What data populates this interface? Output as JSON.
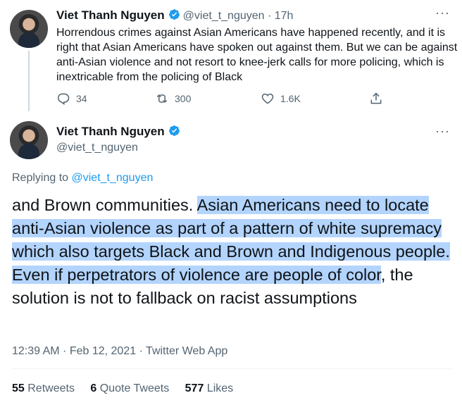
{
  "tweet1": {
    "name": "Viet Thanh Nguyen",
    "handle": "@viet_t_nguyen",
    "time": "· 17h",
    "text": "Horrendous crimes against Asian Americans have happened recently, and it is right that Asian Americans have spoken out against them. But we can be against anti-Asian violence and not resort to knee-jerk calls for more policing, which is inextricable from the policing of Black",
    "replies": "34",
    "retweets": "300",
    "likes": "1.6K"
  },
  "tweet2": {
    "name": "Viet Thanh Nguyen",
    "handle": "@viet_t_nguyen",
    "replying_prefix": "Replying to ",
    "replying_handle": "@viet_t_nguyen",
    "text_plain_start": "and Brown communities. ",
    "text_highlighted": "Asian Americans need to locate anti-Asian violence as part of a pattern of white supremacy which also targets Black and Brown and Indigenous people. Even if perpetrators of violence are people of color",
    "text_plain_end": ", the solution is not to fallback on racist assumptions",
    "meta": "12:39 AM · Feb 12, 2021 · Twitter Web App",
    "stats": {
      "retweets_count": "55",
      "retweets_label": "Retweets",
      "quotes_count": "6",
      "quotes_label": "Quote Tweets",
      "likes_count": "577",
      "likes_label": "Likes"
    }
  },
  "colors": {
    "accent": "#1d9bf0",
    "highlight": "#b3d4fc",
    "muted": "#536471"
  }
}
